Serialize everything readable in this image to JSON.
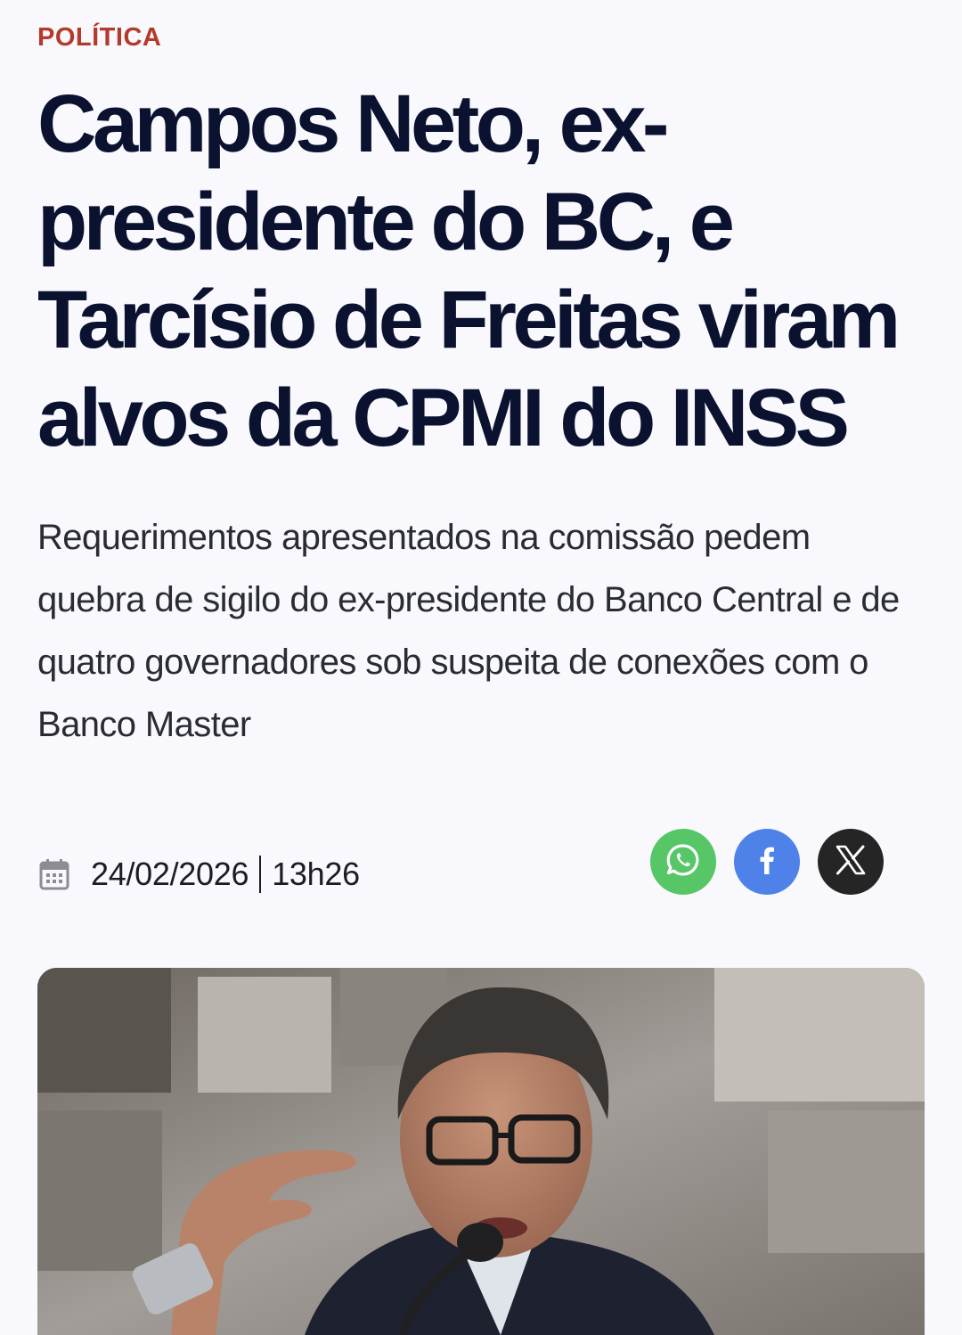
{
  "article": {
    "category": "POLÍTICA",
    "headline": "Campos Neto, ex-presidente do BC, e Tarcísio de Freitas viram alvos da CPMI do INSS",
    "subtitle": "Requerimentos apresentados na comissão pedem quebra de sigilo do ex-presidente do Banco Central e de quatro governadores sob suspeita de conexões com o Banco Master",
    "date": "24/02/2026",
    "time": "13h26"
  },
  "share": {
    "buttons": [
      {
        "icon": "whatsapp-icon",
        "color": "#56c666"
      },
      {
        "icon": "facebook-icon",
        "color": "#4f82e8"
      },
      {
        "icon": "x-icon",
        "color": "#252526"
      }
    ]
  },
  "theme": {
    "background": "#f9f8fd",
    "category_color": "#b43a2a",
    "headline_color": "#0a1230"
  },
  "media": {
    "photo_icon": "article-photo"
  }
}
